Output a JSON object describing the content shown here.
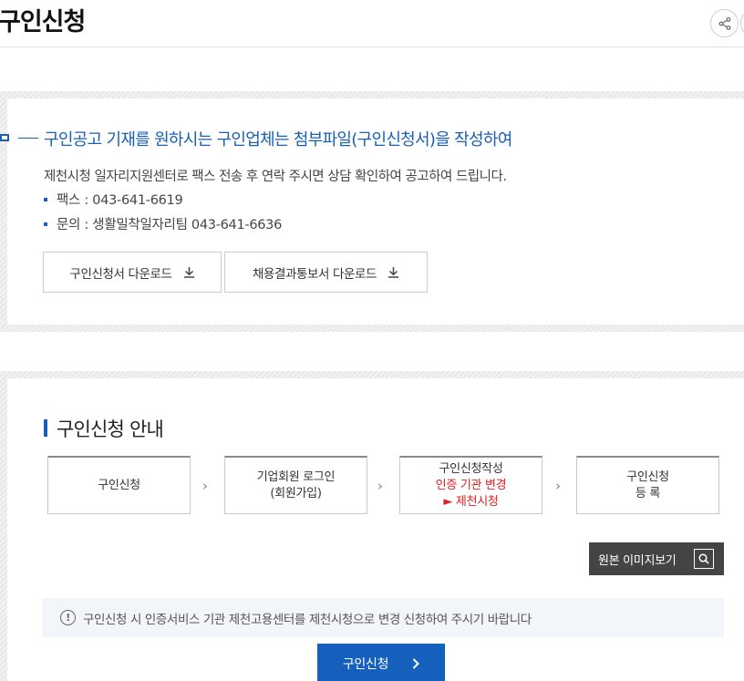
{
  "page": {
    "title": "구인신청"
  },
  "header": {
    "share_icon": "share-icon"
  },
  "notice": {
    "title": "구인공고 기재를 원하시는 구인업체는 첨부파일(구인신청서)을 작성하여",
    "description": "제천시청 일자리지원센터로 팩스 전송 후 연락 주시면 상담 확인하여 공고하여 드립니다.",
    "items": [
      "팩스 : 043-641-6619",
      "문의 : 생활밀착일자리팀 043-641-6636"
    ],
    "buttons": [
      {
        "label": "구인신청서 다운로드",
        "icon": "download-icon"
      },
      {
        "label": "채용결과통보서 다운로드",
        "icon": "download-icon"
      }
    ]
  },
  "guide": {
    "title": "구인신청 안내",
    "steps": [
      {
        "lines": [
          "구인신청"
        ]
      },
      {
        "lines": [
          "기업회원 로그인",
          "(회원가입)"
        ]
      },
      {
        "lines": [
          "구인신청작성"
        ],
        "highlight": [
          "인증 기관 변경",
          "► 제천시청"
        ]
      },
      {
        "lines": [
          "구인신청",
          "등 록"
        ]
      }
    ],
    "arrow_glyph": "›",
    "original_image_button": "원본 이미지보기",
    "alert": "구인신청 시 인증서비스 기관 제천고용센터를 제천시청으로 변경 신청하여 주시기 바랍니다",
    "apply_button": "구인신청"
  },
  "colors": {
    "accent": "#1560bd",
    "highlight_red": "#e02020",
    "dark_button": "#444444"
  }
}
